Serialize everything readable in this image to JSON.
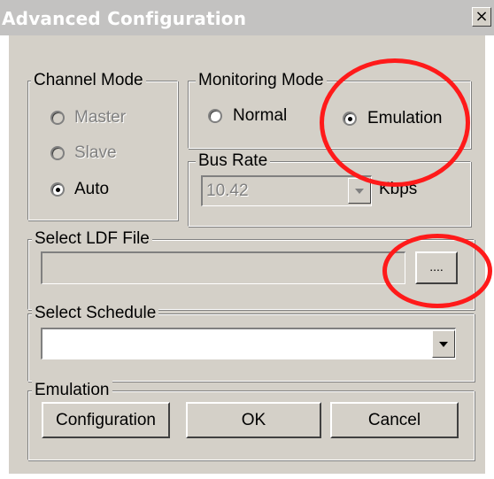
{
  "window": {
    "title": "Advanced Configuration",
    "close_glyph": "×"
  },
  "channel_mode": {
    "title": "Channel Mode",
    "options": [
      {
        "label": "Master",
        "selected": false,
        "enabled": false
      },
      {
        "label": "Slave",
        "selected": false,
        "enabled": false
      },
      {
        "label": "Auto",
        "selected": true,
        "enabled": true
      }
    ]
  },
  "monitoring_mode": {
    "title": "Monitoring Mode",
    "options": [
      {
        "label": "Normal",
        "selected": false,
        "enabled": true
      },
      {
        "label": "Emulation",
        "selected": true,
        "enabled": true
      }
    ]
  },
  "bus_rate": {
    "title": "Bus Rate",
    "value": "10.42",
    "unit": "Kbps",
    "enabled": false
  },
  "ldf_file": {
    "title": "Select LDF File",
    "path": "",
    "browse_label": "...."
  },
  "schedule": {
    "title": "Select Schedule",
    "value": ""
  },
  "emulation": {
    "title": "Emulation",
    "configuration_label": "Configuration",
    "ok_label": "OK",
    "cancel_label": "Cancel"
  },
  "highlights": {
    "color": "#ff1a1a"
  }
}
